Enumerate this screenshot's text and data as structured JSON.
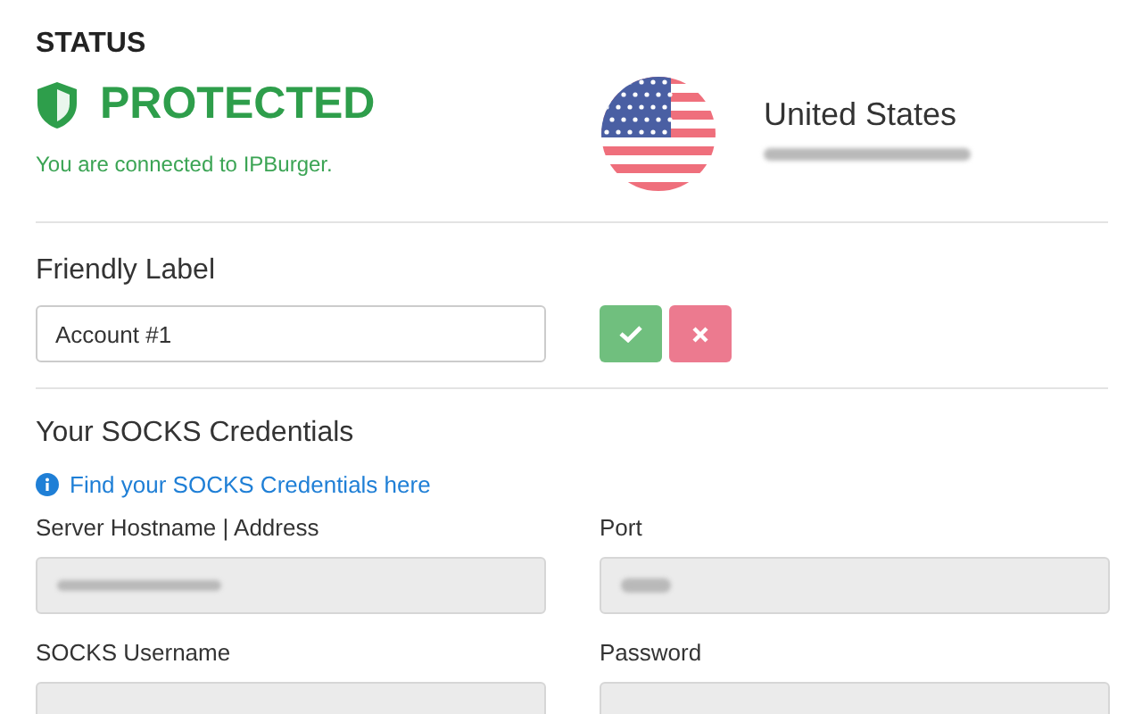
{
  "status": {
    "heading": "STATUS",
    "protected": true,
    "title": "PROTECTED",
    "message": "You are connected to IPBurger."
  },
  "location": {
    "country": "United States"
  },
  "friendly_label": {
    "label": "Friendly Label",
    "value": "Account #1"
  },
  "label_buttons": [
    {
      "kind": "confirm"
    },
    {
      "kind": "cancel"
    }
  ],
  "credentials": {
    "heading": "Your SOCKS Credentials",
    "link": "Find your SOCKS Credentials here",
    "fields": [
      {
        "label": "Server Hostname | Address",
        "disabled": true,
        "value_redacted": true
      },
      {
        "label": "Port",
        "disabled": true,
        "value_redacted": true
      },
      {
        "label": "SOCKS Username",
        "disabled": true,
        "value_redacted": false
      },
      {
        "label": "Password",
        "disabled": true,
        "value_redacted": false
      }
    ]
  }
}
